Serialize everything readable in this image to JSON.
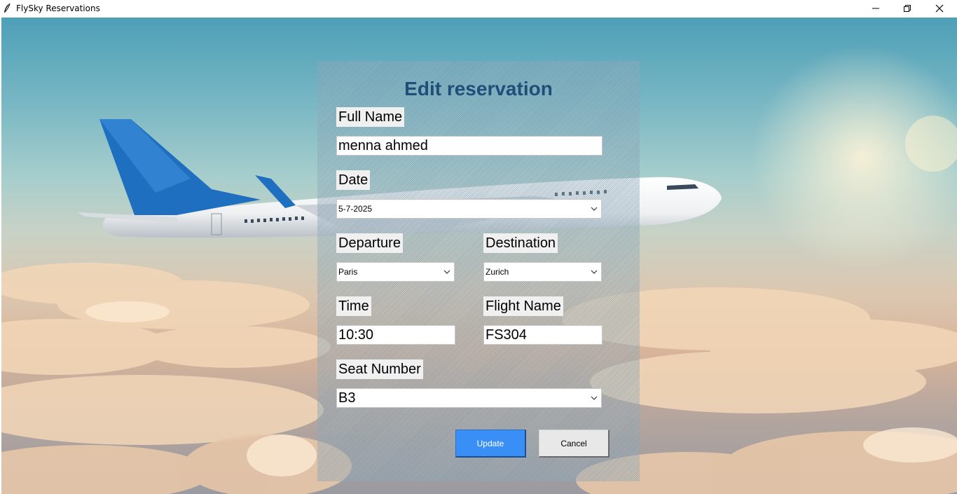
{
  "window": {
    "title": "FlySky Reservations",
    "icons": {
      "app": "feather-icon",
      "minimize": "minimize-icon",
      "maximize": "restore-icon",
      "close": "close-icon"
    }
  },
  "form": {
    "title": "Edit reservation",
    "full_name": {
      "label": "Full Name",
      "value": "menna ahmed"
    },
    "date": {
      "label": "Date",
      "value": "5-7-2025"
    },
    "departure": {
      "label": "Departure",
      "value": "Paris"
    },
    "destination": {
      "label": "Destination",
      "value": "Zurich"
    },
    "time": {
      "label": "Time",
      "value": "10:30"
    },
    "flight_name": {
      "label": "Flight Name",
      "value": "FS304"
    },
    "seat_number": {
      "label": "Seat Number",
      "value": "B3"
    },
    "update_label": "Update",
    "cancel_label": "Cancel"
  },
  "colors": {
    "title": "#1f4e79",
    "update_button": "#3a8ff7",
    "cancel_button": "#e8e8e8",
    "airplane_tail": "#1f6fc0"
  }
}
